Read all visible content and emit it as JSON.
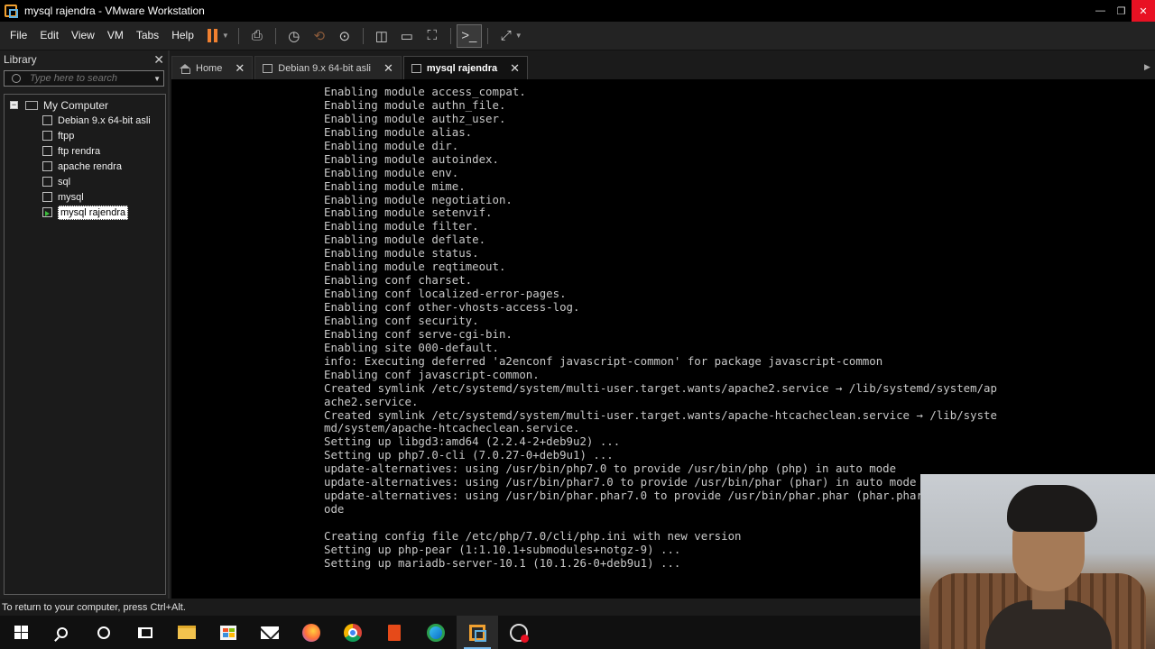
{
  "window": {
    "title": "mysql rajendra - VMware Workstation"
  },
  "menu": [
    "File",
    "Edit",
    "View",
    "VM",
    "Tabs",
    "Help"
  ],
  "library": {
    "title": "Library",
    "search_placeholder": "Type here to search",
    "root": "My Computer",
    "items": [
      {
        "label": "Debian 9.x 64-bit asli",
        "running": false,
        "selected": false
      },
      {
        "label": "ftpp",
        "running": false,
        "selected": false
      },
      {
        "label": "ftp rendra",
        "running": false,
        "selected": false
      },
      {
        "label": "apache rendra",
        "running": false,
        "selected": false
      },
      {
        "label": "sql",
        "running": false,
        "selected": false
      },
      {
        "label": "mysql",
        "running": false,
        "selected": false
      },
      {
        "label": "mysql rajendra",
        "running": true,
        "selected": true
      }
    ]
  },
  "tabs": [
    {
      "label": "Home",
      "icon": "home-icon",
      "active": false
    },
    {
      "label": "Debian 9.x 64-bit asli",
      "icon": "vm-icon",
      "active": false
    },
    {
      "label": "mysql rajendra",
      "icon": "vm-icon",
      "active": true
    }
  ],
  "console": {
    "lines": [
      "Enabling module access_compat.",
      "Enabling module authn_file.",
      "Enabling module authz_user.",
      "Enabling module alias.",
      "Enabling module dir.",
      "Enabling module autoindex.",
      "Enabling module env.",
      "Enabling module mime.",
      "Enabling module negotiation.",
      "Enabling module setenvif.",
      "Enabling module filter.",
      "Enabling module deflate.",
      "Enabling module status.",
      "Enabling module reqtimeout.",
      "Enabling conf charset.",
      "Enabling conf localized-error-pages.",
      "Enabling conf other-vhosts-access-log.",
      "Enabling conf security.",
      "Enabling conf serve-cgi-bin.",
      "Enabling site 000-default.",
      "info: Executing deferred 'a2enconf javascript-common' for package javascript-common",
      "Enabling conf javascript-common.",
      "Created symlink /etc/systemd/system/multi-user.target.wants/apache2.service → /lib/systemd/system/ap",
      "ache2.service.",
      "Created symlink /etc/systemd/system/multi-user.target.wants/apache-htcacheclean.service → /lib/syste",
      "md/system/apache-htcacheclean.service.",
      "Setting up libgd3:amd64 (2.2.4-2+deb9u2) ...",
      "Setting up php7.0-cli (7.0.27-0+deb9u1) ...",
      "update-alternatives: using /usr/bin/php7.0 to provide /usr/bin/php (php) in auto mode",
      "update-alternatives: using /usr/bin/phar7.0 to provide /usr/bin/phar (phar) in auto mode",
      "update-alternatives: using /usr/bin/phar.phar7.0 to provide /usr/bin/phar.phar (phar.phar) in auto m",
      "ode",
      "",
      "Creating config file /etc/php/7.0/cli/php.ini with new version",
      "Setting up php-pear (1:1.10.1+submodules+notgz-9) ...",
      "Setting up mariadb-server-10.1 (10.1.26-0+deb9u1) ..."
    ]
  },
  "status": {
    "text": "To return to your computer, press Ctrl+Alt."
  },
  "taskbar": {
    "apps": [
      "windows-start-icon",
      "search-icon",
      "cortana-icon",
      "task-view-icon",
      "file-explorer-icon",
      "store-icon",
      "mail-icon",
      "firefox-icon",
      "chrome-icon",
      "office-icon",
      "edge-icon",
      "vmware-icon",
      "recorder-icon"
    ],
    "active_app": "vmware-icon"
  },
  "colors": {
    "pause_accent": "#f08030",
    "running_green": "#3cbc3c",
    "console_bg": "#000000",
    "close_red": "#e81123"
  }
}
